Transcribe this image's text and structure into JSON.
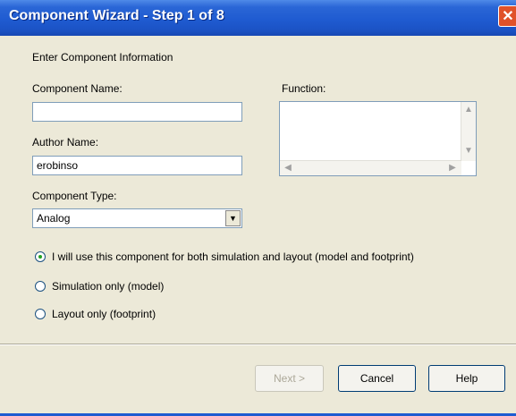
{
  "window": {
    "title": "Component Wizard - Step 1 of 8",
    "close_glyph": "✕"
  },
  "header": {
    "instruction": "Enter Component Information"
  },
  "form": {
    "component_name": {
      "label": "Component Name:",
      "value": ""
    },
    "author_name": {
      "label": "Author Name:",
      "value": "erobinso"
    },
    "function": {
      "label": "Function:",
      "value": ""
    },
    "component_type": {
      "label": "Component Type:",
      "value": "Analog"
    }
  },
  "radios": [
    {
      "label": "I will use this component for both simulation and layout (model and footprint)",
      "checked": true
    },
    {
      "label": "Simulation only (model)",
      "checked": false
    },
    {
      "label": "Layout only (footprint)",
      "checked": false
    }
  ],
  "buttons": {
    "next": "Next >",
    "cancel": "Cancel",
    "help": "Help"
  },
  "icons": {
    "close": "close-icon",
    "dropdown": "chevron-down-icon"
  },
  "colors": {
    "titlebar": "#1f5bd1",
    "dialog": "#ece9d8",
    "close": "#e0522a"
  }
}
